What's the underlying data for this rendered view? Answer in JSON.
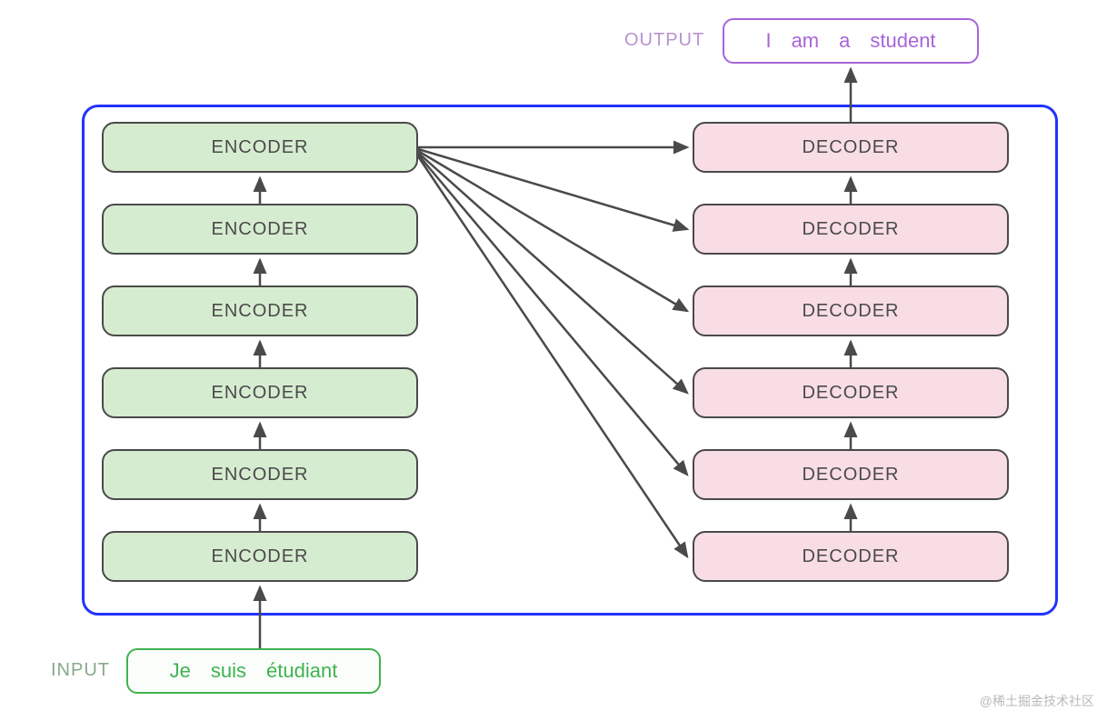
{
  "encoders": [
    "ENCODER",
    "ENCODER",
    "ENCODER",
    "ENCODER",
    "ENCODER",
    "ENCODER"
  ],
  "decoders": [
    "DECODER",
    "DECODER",
    "DECODER",
    "DECODER",
    "DECODER",
    "DECODER"
  ],
  "input": {
    "label": "INPUT",
    "tokens": [
      "Je",
      "suis",
      "étudiant"
    ]
  },
  "output": {
    "label": "OUTPUT",
    "tokens": [
      "I",
      "am",
      "a",
      "student"
    ]
  },
  "watermark": "@稀土掘金技术社区",
  "colors": {
    "container_border": "#2233ff",
    "encoder_fill": "#d6ecd0",
    "decoder_fill": "#f8dde5",
    "block_border": "#4a4a4a",
    "input_accent": "#3fb34f",
    "output_accent": "#a865d8",
    "arrow": "#4a4a4a"
  }
}
